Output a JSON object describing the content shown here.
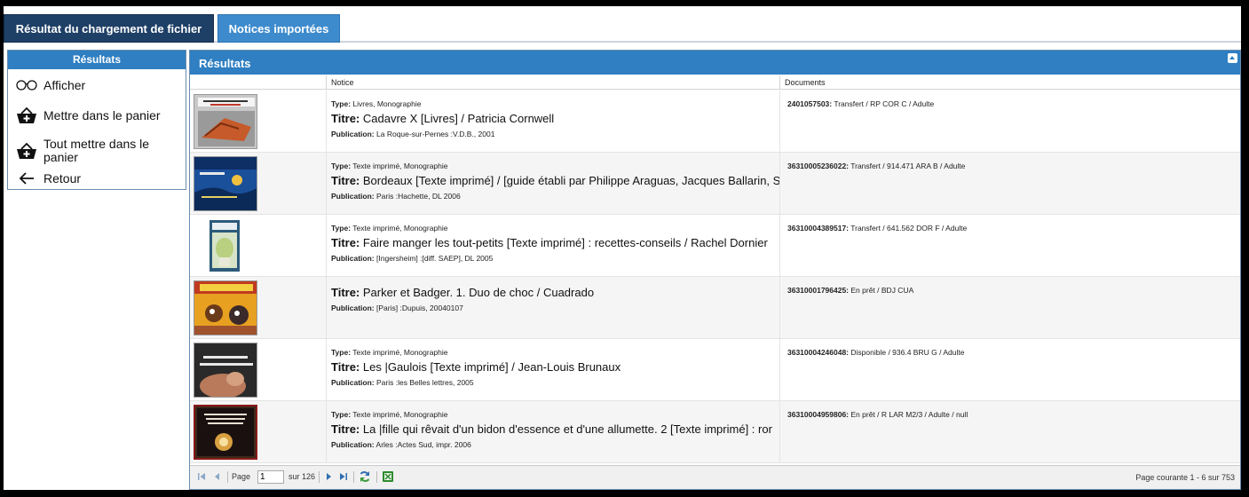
{
  "tabs": {
    "chargement": "Résultat du chargement de fichier",
    "notices": "Notices importées"
  },
  "sidebar": {
    "header": "Résultats",
    "items": [
      {
        "label": "Afficher",
        "icon": "glasses-icon"
      },
      {
        "label": "Mettre dans le panier",
        "icon": "basket-add-icon"
      },
      {
        "label": "Tout mettre dans le panier",
        "icon": "basket-add-icon"
      },
      {
        "label": "Retour",
        "icon": "arrow-left-icon"
      }
    ]
  },
  "main": {
    "header": "Résultats",
    "columns": [
      "Notice",
      "Documents"
    ],
    "labels": {
      "type": "Type:",
      "titre": "Titre:",
      "publication": "Publication:"
    },
    "rows": [
      {
        "type": "Livres, Monographie",
        "titre": "Cadavre X [Livres] / Patricia Cornwell",
        "publication": "La Roque-sur-Pernes :V.D.B., 2001",
        "doc_id": "2401057503:",
        "doc_info": "Transfert / RP COR C / Adulte",
        "cover_colors": [
          "#b8b8b8",
          "#c65a2a"
        ]
      },
      {
        "type": "Texte imprimé, Monographie",
        "titre": "Bordeaux [Texte imprimé] / [guide établi par Philippe Araguas, Jacques Ballarin, S",
        "publication": "Paris :Hachette, DL 2006",
        "doc_id": "36310005236022:",
        "doc_info": "Transfert / 914.471 ARA B / Adulte",
        "cover_colors": [
          "#1a4f9a",
          "#0e2e66"
        ]
      },
      {
        "type": "Texte imprimé, Monographie",
        "titre": "Faire manger les tout-petits [Texte imprimé] : recettes-conseils / Rachel Dornier",
        "publication": "[Ingersheim] :[diff. SAEP], DL 2005",
        "doc_id": "36310004389517:",
        "doc_info": "Transfert / 641.562 DOR F / Adulte",
        "cover_colors": [
          "#2c5a7a",
          "#c8d8a0"
        ]
      },
      {
        "type": "",
        "titre": "Parker et Badger. 1. Duo de choc / Cuadrado",
        "publication": "[Paris] :Dupuis, 20040107",
        "doc_id": "36310001796425:",
        "doc_info": "En prêt / BDJ CUA",
        "cover_colors": [
          "#e8a020",
          "#c03a20"
        ]
      },
      {
        "type": "Texte imprimé, Monographie",
        "titre": "Les |Gaulois [Texte imprimé] / Jean-Louis Brunaux",
        "publication": "Paris :les Belles lettres, 2005",
        "doc_id": "36310004246048:",
        "doc_info": "Disponible / 936.4 BRU G / Adulte",
        "cover_colors": [
          "#2a2a2a",
          "#b87a5a"
        ]
      },
      {
        "type": "Texte imprimé, Monographie",
        "titre": "La |fille qui rêvait d'un bidon d'essence et d'une allumette. 2 [Texte imprimé] : ror",
        "publication": "Arles :Actes Sud, impr. 2006",
        "doc_id": "36310004959806:",
        "doc_info": "En prêt / R LAR M2/3 / Adulte / null",
        "cover_colors": [
          "#8a1a1a",
          "#3a2a1a"
        ]
      }
    ]
  },
  "pager": {
    "page_label": "Page",
    "page_value": "1",
    "total": "sur 126",
    "status": "Page courante 1 - 6 sur 753"
  }
}
